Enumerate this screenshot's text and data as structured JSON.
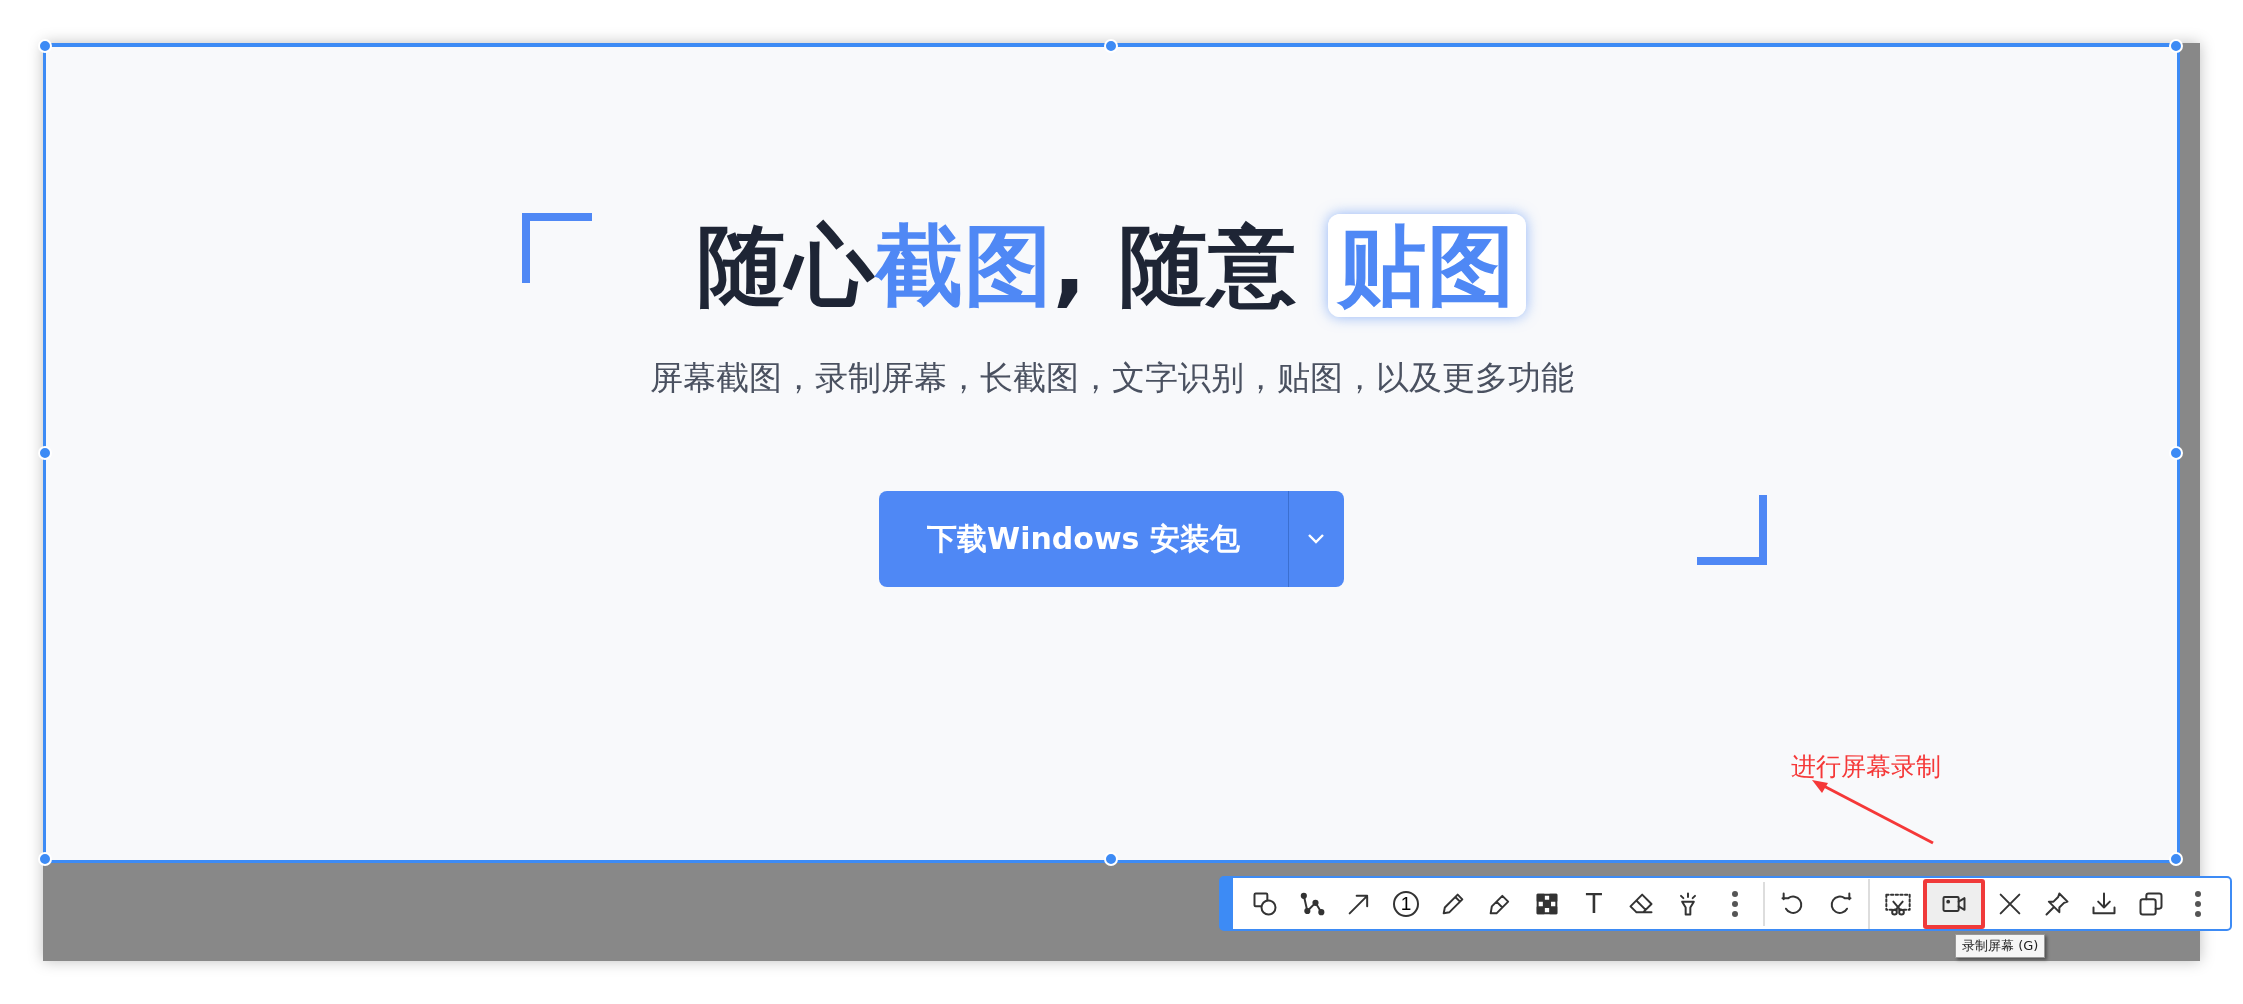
{
  "headline": {
    "parts": [
      {
        "text": "随心",
        "kind": "plain"
      },
      {
        "text": "截图",
        "kind": "accent"
      },
      {
        "text": ", 随意 ",
        "kind": "plain"
      },
      {
        "text": "贴图",
        "kind": "boxed"
      }
    ]
  },
  "subtitle": "屏幕截图，录制屏幕，长截图，文字识别，贴图，以及更多功能",
  "download_button": {
    "label": "下载Windows 安装包"
  },
  "annotation": {
    "text": "进行屏幕录制"
  },
  "toolbar": {
    "groups": [
      {
        "items": [
          {
            "selected": false
          },
          {
            "selected": false
          },
          {
            "selected": false
          },
          {
            "selected": false,
            "label": "1"
          },
          {
            "selected": false
          },
          {
            "selected": false
          },
          {
            "selected": false
          },
          {
            "selected": false,
            "label": "T"
          },
          {
            "selected": false
          },
          {
            "selected": false
          },
          {
            "selected": false
          }
        ]
      },
      {
        "items": [
          {
            "selected": false
          },
          {
            "selected": false
          }
        ]
      },
      {
        "items": [
          {
            "selected": false
          },
          {
            "selected": true
          },
          {
            "selected": false
          },
          {
            "selected": false
          },
          {
            "selected": false
          },
          {
            "selected": false
          },
          {
            "selected": false
          }
        ]
      }
    ]
  },
  "tooltip": "录制屏幕 (G)"
}
